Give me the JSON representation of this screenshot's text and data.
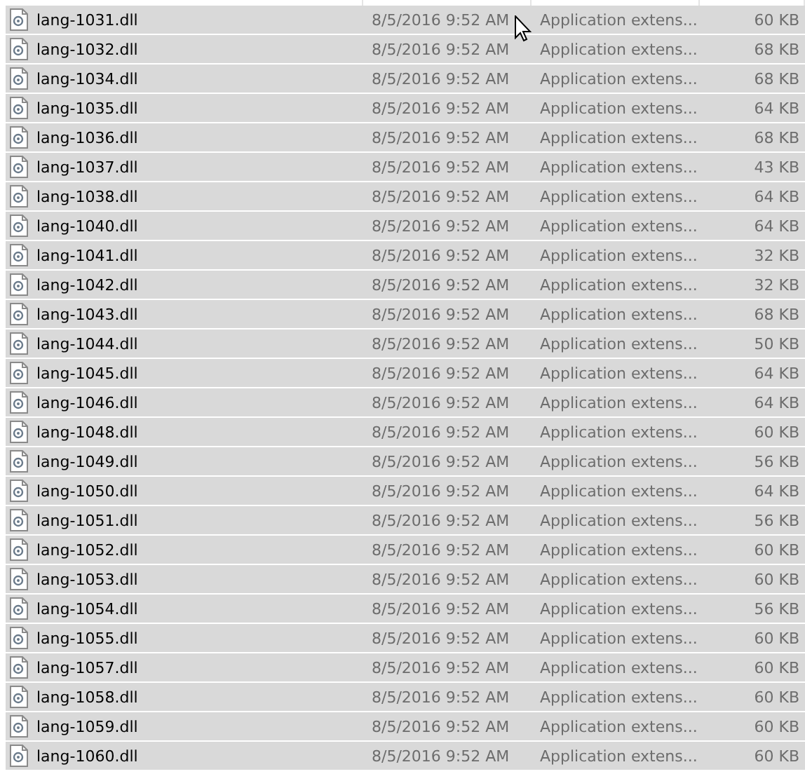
{
  "files": [
    {
      "name": "lang-1031.dll",
      "date": "8/5/2016 9:52 AM",
      "type": "Application extens...",
      "size": "60 KB",
      "selected": true
    },
    {
      "name": "lang-1032.dll",
      "date": "8/5/2016 9:52 AM",
      "type": "Application extens...",
      "size": "68 KB",
      "selected": true
    },
    {
      "name": "lang-1034.dll",
      "date": "8/5/2016 9:52 AM",
      "type": "Application extens...",
      "size": "68 KB",
      "selected": true
    },
    {
      "name": "lang-1035.dll",
      "date": "8/5/2016 9:52 AM",
      "type": "Application extens...",
      "size": "64 KB",
      "selected": true
    },
    {
      "name": "lang-1036.dll",
      "date": "8/5/2016 9:52 AM",
      "type": "Application extens...",
      "size": "68 KB",
      "selected": true
    },
    {
      "name": "lang-1037.dll",
      "date": "8/5/2016 9:52 AM",
      "type": "Application extens...",
      "size": "43 KB",
      "selected": true
    },
    {
      "name": "lang-1038.dll",
      "date": "8/5/2016 9:52 AM",
      "type": "Application extens...",
      "size": "64 KB",
      "selected": true
    },
    {
      "name": "lang-1040.dll",
      "date": "8/5/2016 9:52 AM",
      "type": "Application extens...",
      "size": "64 KB",
      "selected": true
    },
    {
      "name": "lang-1041.dll",
      "date": "8/5/2016 9:52 AM",
      "type": "Application extens...",
      "size": "32 KB",
      "selected": true
    },
    {
      "name": "lang-1042.dll",
      "date": "8/5/2016 9:52 AM",
      "type": "Application extens...",
      "size": "32 KB",
      "selected": true
    },
    {
      "name": "lang-1043.dll",
      "date": "8/5/2016 9:52 AM",
      "type": "Application extens...",
      "size": "68 KB",
      "selected": true
    },
    {
      "name": "lang-1044.dll",
      "date": "8/5/2016 9:52 AM",
      "type": "Application extens...",
      "size": "50 KB",
      "selected": true
    },
    {
      "name": "lang-1045.dll",
      "date": "8/5/2016 9:52 AM",
      "type": "Application extens...",
      "size": "64 KB",
      "selected": true
    },
    {
      "name": "lang-1046.dll",
      "date": "8/5/2016 9:52 AM",
      "type": "Application extens...",
      "size": "64 KB",
      "selected": true
    },
    {
      "name": "lang-1048.dll",
      "date": "8/5/2016 9:52 AM",
      "type": "Application extens...",
      "size": "60 KB",
      "selected": true
    },
    {
      "name": "lang-1049.dll",
      "date": "8/5/2016 9:52 AM",
      "type": "Application extens...",
      "size": "56 KB",
      "selected": true
    },
    {
      "name": "lang-1050.dll",
      "date": "8/5/2016 9:52 AM",
      "type": "Application extens...",
      "size": "64 KB",
      "selected": true
    },
    {
      "name": "lang-1051.dll",
      "date": "8/5/2016 9:52 AM",
      "type": "Application extens...",
      "size": "56 KB",
      "selected": true
    },
    {
      "name": "lang-1052.dll",
      "date": "8/5/2016 9:52 AM",
      "type": "Application extens...",
      "size": "60 KB",
      "selected": true
    },
    {
      "name": "lang-1053.dll",
      "date": "8/5/2016 9:52 AM",
      "type": "Application extens...",
      "size": "60 KB",
      "selected": true
    },
    {
      "name": "lang-1054.dll",
      "date": "8/5/2016 9:52 AM",
      "type": "Application extens...",
      "size": "56 KB",
      "selected": true
    },
    {
      "name": "lang-1055.dll",
      "date": "8/5/2016 9:52 AM",
      "type": "Application extens...",
      "size": "60 KB",
      "selected": true
    },
    {
      "name": "lang-1057.dll",
      "date": "8/5/2016 9:52 AM",
      "type": "Application extens...",
      "size": "60 KB",
      "selected": true
    },
    {
      "name": "lang-1058.dll",
      "date": "8/5/2016 9:52 AM",
      "type": "Application extens...",
      "size": "60 KB",
      "selected": true
    },
    {
      "name": "lang-1059.dll",
      "date": "8/5/2016 9:52 AM",
      "type": "Application extens...",
      "size": "60 KB",
      "selected": true
    },
    {
      "name": "lang-1060.dll",
      "date": "8/5/2016 9:52 AM",
      "type": "Application extens...",
      "size": "60 KB",
      "selected": true
    }
  ]
}
